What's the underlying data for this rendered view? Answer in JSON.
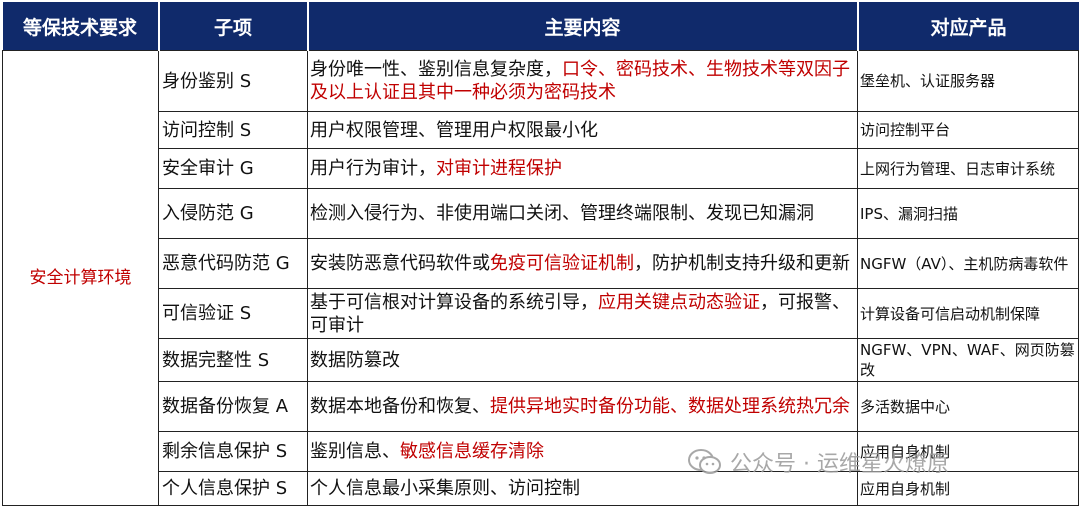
{
  "header": {
    "col1": "等保技术要求",
    "col2": "子项",
    "col3": "主要内容",
    "col4": "对应产品"
  },
  "requirement": "安全计算环境",
  "rows": [
    {
      "sub": "身份鉴别 S",
      "content_plain": "身份唯一性、鉴别信息复杂度，",
      "content_red": "口令、密码技术、生物技术等双因子及以上认证且其中一种必须为密码技术",
      "content_after": "",
      "product": "堡垒机、认证服务器"
    },
    {
      "sub": "访问控制 S",
      "content_plain": "用户权限管理、管理用户权限最小化",
      "content_red": "",
      "content_after": "",
      "product": "访问控制平台"
    },
    {
      "sub": "安全审计 G",
      "content_plain": "用户行为审计，",
      "content_red": "对审计进程保护",
      "content_after": "",
      "product": "上网行为管理、日志审计系统"
    },
    {
      "sub": "入侵防范 G",
      "content_plain": "检测入侵行为、非使用端口关闭、管理终端限制、发现已知漏洞",
      "content_red": "",
      "content_after": "",
      "product": "IPS、漏洞扫描"
    },
    {
      "sub": "恶意代码防范 G",
      "content_plain": "安装防恶意代码软件或",
      "content_red": "免疫可信验证机制",
      "content_after": "，防护机制支持升级和更新",
      "product": "NGFW（AV）、主机防病毒软件"
    },
    {
      "sub": "可信验证 S",
      "content_plain": "基于可信根对计算设备的系统引导，",
      "content_red": "应用关键点动态验证",
      "content_after": "，可报警、可审计",
      "product": "计算设备可信启动机制保障"
    },
    {
      "sub": "数据完整性 S",
      "content_plain": "数据防篡改",
      "content_red": "",
      "content_after": "",
      "product": "NGFW、VPN、WAF、网页防篡改"
    },
    {
      "sub": "数据备份恢复 A",
      "content_plain": "数据本地备份和恢复、",
      "content_red": "提供异地实时备份功能、数据处理系统热冗余",
      "content_after": "",
      "product": "多活数据中心"
    },
    {
      "sub": "剩余信息保护 S",
      "content_plain": "鉴别信息、",
      "content_red": "敏感信息缓存清除",
      "content_after": "",
      "product": "应用自身机制"
    },
    {
      "sub": "个人信息保护 S",
      "content_plain": "个人信息最小采集原则、访问控制",
      "content_red": "",
      "content_after": "",
      "product": "应用自身机制"
    }
  ],
  "watermark": {
    "text": "公众号 · 运维星火燎原",
    "icon": "wechat-icon"
  }
}
